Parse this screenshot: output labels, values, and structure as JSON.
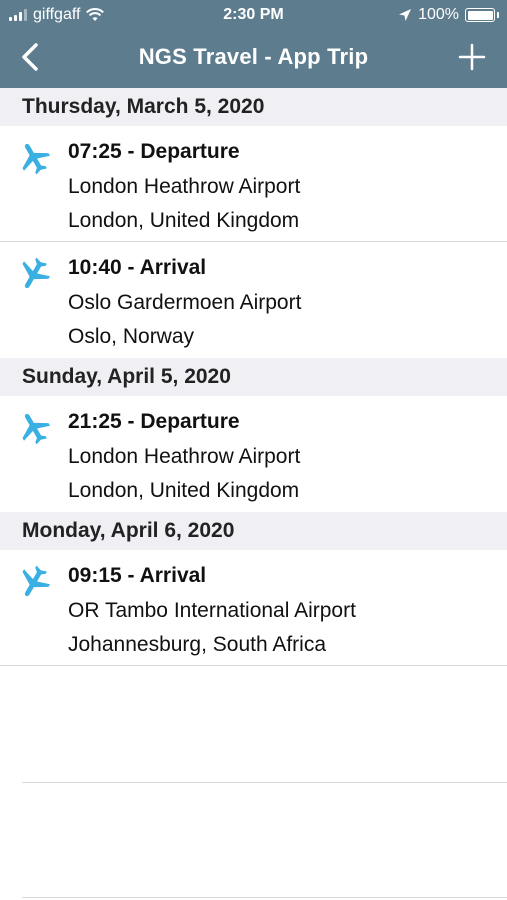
{
  "status_bar": {
    "carrier": "giffgaff",
    "time": "2:30 PM",
    "battery": "100%"
  },
  "nav": {
    "title": "NGS Travel - App Trip",
    "back_icon": "chevron-left-icon",
    "add_icon": "plus-icon"
  },
  "colors": {
    "header_bg": "#5d7d8f",
    "plane_icon": "#3ab0e2",
    "section_bg": "#efeff4"
  },
  "sections": [
    {
      "date": "Thursday, March 5, 2020",
      "items": [
        {
          "title": "07:25 - Departure",
          "airport": "London Heathrow Airport",
          "city": "London, United Kingdom",
          "icon": "plane-departure-icon"
        },
        {
          "title": "10:40 - Arrival",
          "airport": "Oslo Gardermoen Airport",
          "city": "Oslo, Norway",
          "icon": "plane-arrival-icon"
        }
      ]
    },
    {
      "date": "Sunday, April 5, 2020",
      "items": [
        {
          "title": "21:25 - Departure",
          "airport": "London Heathrow Airport",
          "city": "London, United Kingdom",
          "icon": "plane-departure-icon"
        }
      ]
    },
    {
      "date": "Monday, April 6, 2020",
      "items": [
        {
          "title": "09:15 - Arrival",
          "airport": "OR Tambo International Airport",
          "city": "Johannesburg, South Africa",
          "icon": "plane-arrival-icon"
        }
      ]
    }
  ]
}
